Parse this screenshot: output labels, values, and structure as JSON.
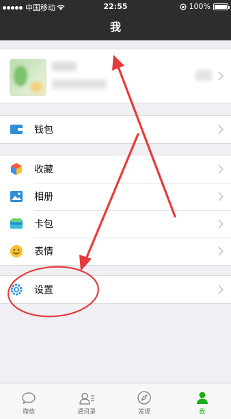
{
  "status_bar": {
    "carrier": "中国移动",
    "time": "22:55",
    "battery": "100%"
  },
  "nav": {
    "title": "我"
  },
  "menu": {
    "wallet": "钱包",
    "favorites": "收藏",
    "album": "相册",
    "cards": "卡包",
    "stickers": "表情",
    "settings": "设置"
  },
  "tabs": [
    "微信",
    "通讯录",
    "发现",
    "我"
  ],
  "colors": {
    "accent": "#1aad19",
    "bar": "#2d2d30",
    "annotation": "#e83a3a"
  },
  "icons": {
    "wallet": "wallet-icon",
    "favorites": "cube-icon",
    "album": "picture-icon",
    "cards": "card-icon",
    "stickers": "smile-icon",
    "settings": "gear-icon"
  }
}
